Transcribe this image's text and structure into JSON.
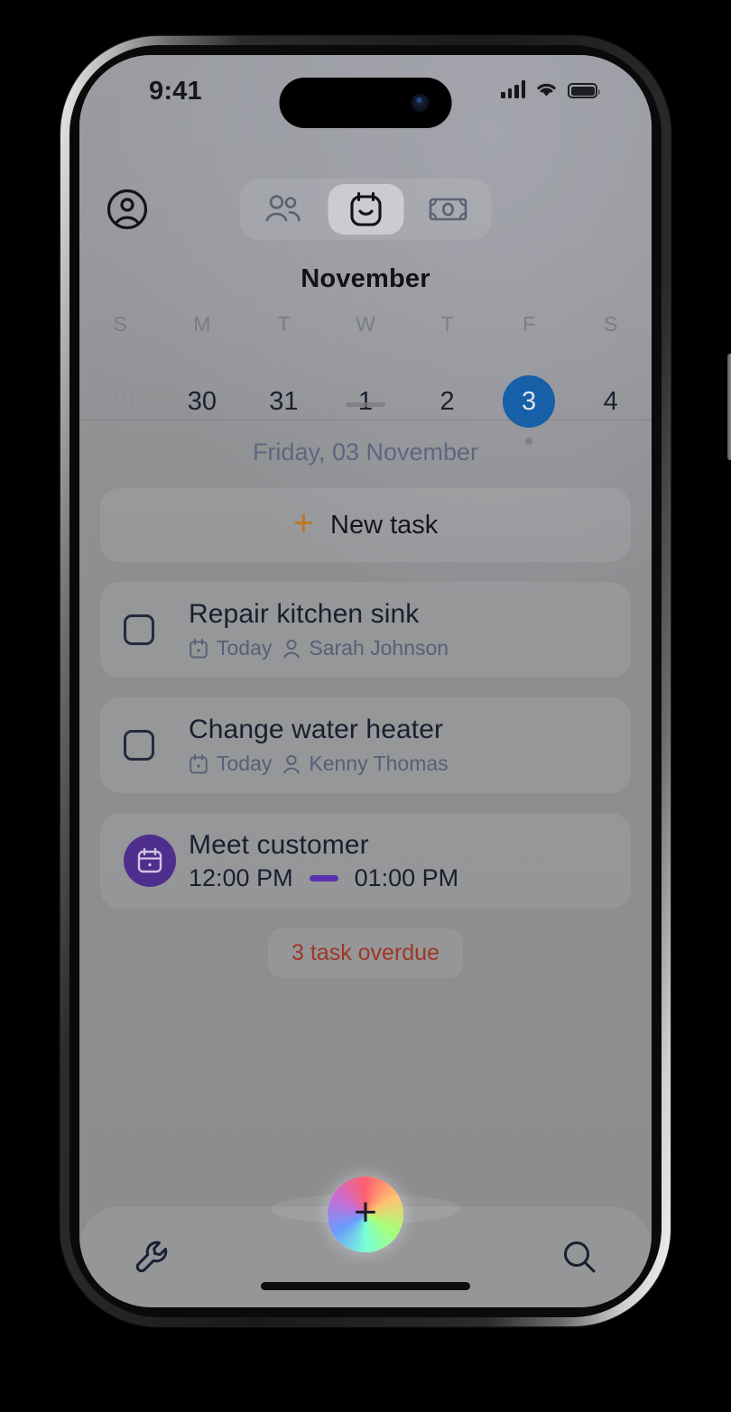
{
  "status_bar": {
    "time": "9:41",
    "cellular_icon": "signal-bars-icon",
    "wifi_icon": "wifi-icon",
    "battery_icon": "battery-icon"
  },
  "top_bar": {
    "avatar_icon": "user-circle-icon",
    "segments": [
      {
        "name": "contacts",
        "icon": "people-icon",
        "active": false
      },
      {
        "name": "calendar",
        "icon": "calendar-smile-icon",
        "active": true
      },
      {
        "name": "money",
        "icon": "banknote-icon",
        "active": false
      }
    ]
  },
  "calendar": {
    "month": "November",
    "weekday_labels": [
      "S",
      "M",
      "T",
      "W",
      "T",
      "F",
      "S"
    ],
    "days": [
      {
        "num": "29",
        "muted": true,
        "selected": false,
        "has_event": false
      },
      {
        "num": "30",
        "muted": false,
        "selected": false,
        "has_event": false
      },
      {
        "num": "31",
        "muted": false,
        "selected": false,
        "has_event": false
      },
      {
        "num": "1",
        "muted": false,
        "selected": false,
        "has_event": false
      },
      {
        "num": "2",
        "muted": false,
        "selected": false,
        "has_event": false
      },
      {
        "num": "3",
        "muted": false,
        "selected": true,
        "has_event": true
      },
      {
        "num": "4",
        "muted": false,
        "selected": false,
        "has_event": false
      }
    ],
    "selected_accent": "#1560a8",
    "grabber": "drag-handle"
  },
  "selected_date_label": "Friday, 03 November",
  "new_task": {
    "plus_glyph": "+",
    "label": "New task",
    "plus_color": "#c27524"
  },
  "tasks": [
    {
      "type": "task",
      "title": "Repair kitchen sink",
      "due_icon": "calendar-dot-icon",
      "due": "Today",
      "person_icon": "person-icon",
      "assignee": "Sarah Johnson",
      "checkbox_checked": false
    },
    {
      "type": "task",
      "title": "Change water heater",
      "due_icon": "calendar-dot-icon",
      "due": "Today",
      "person_icon": "person-icon",
      "assignee": "Kenny Thomas",
      "checkbox_checked": false
    },
    {
      "type": "event",
      "title": "Meet customer",
      "icon": "calendar-event-icon",
      "icon_color": "#4f2f8d",
      "start_time": "12:00 PM",
      "end_time": "01:00 PM",
      "dash_color": "#5a2fb0"
    }
  ],
  "overdue_badge": {
    "label": "3 task overdue",
    "color": "#a03724"
  },
  "tab_bar": {
    "left_icon": "wrench-icon",
    "right_icon": "search-icon",
    "fab_glyph": "+",
    "fab_icon": "add-icon",
    "home_indicator": "home-indicator"
  }
}
